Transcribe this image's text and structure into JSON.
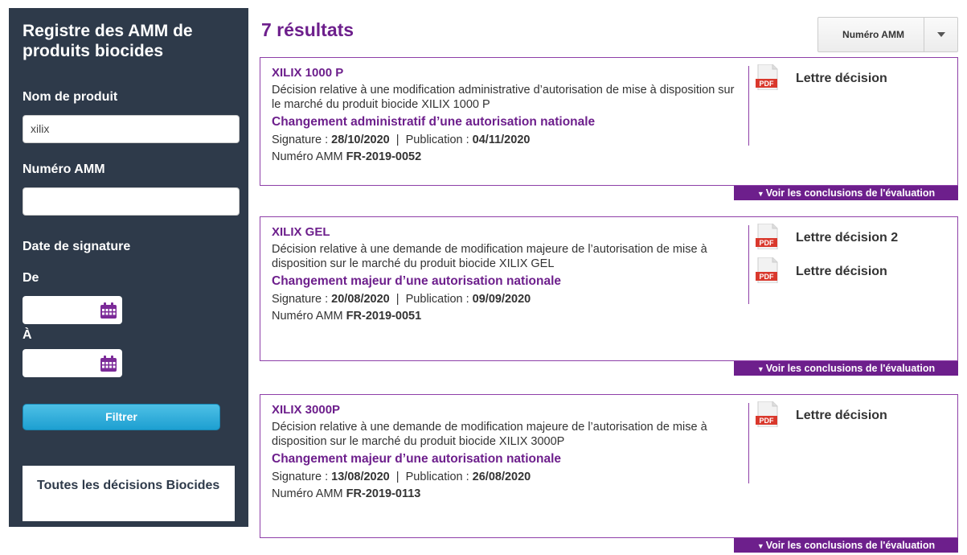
{
  "sidebar": {
    "title": "Registre des AMM de produits biocides",
    "product_name_label": "Nom de produit",
    "product_name_value": "xilix",
    "amm_label": "Numéro AMM",
    "amm_value": "",
    "signature_date_label": "Date de signature",
    "from_label": "De",
    "to_label": "À",
    "filter_button": "Filtrer",
    "all_decisions": "Toutes les décisions Biocides"
  },
  "results": {
    "count_label": "7 résultats",
    "sort_label": "Numéro AMM",
    "eval_link": "Voir les conclusions de l'évaluation",
    "items": [
      {
        "name": "XILIX 1000 P",
        "description": "Décision relative à une modification administrative d’autorisation de mise à disposition sur le marché du produit biocide XILIX 1000 P",
        "type": "Changement administratif d’une autorisation nationale",
        "signature_label": "Signature : ",
        "signature": "28/10/2020",
        "publication_label": "Publication : ",
        "publication": "04/11/2020",
        "amm_label": "Numéro AMM ",
        "amm": "FR-2019-0052",
        "documents": [
          "Lettre décision"
        ]
      },
      {
        "name": "XILIX GEL",
        "description": "Décision relative à une demande de modification majeure de l’autorisation de mise à disposition sur le marché du produit biocide XILIX GEL",
        "type": "Changement majeur d’une autorisation nationale",
        "signature_label": "Signature : ",
        "signature": "20/08/2020",
        "publication_label": "Publication : ",
        "publication": "09/09/2020",
        "amm_label": "Numéro AMM ",
        "amm": "FR-2019-0051",
        "documents": [
          "Lettre décision 2",
          "Lettre décision"
        ]
      },
      {
        "name": "XILIX 3000P",
        "description": "Décision relative à une demande de modification majeure de l’autorisation de mise à disposition sur le marché du produit biocide XILIX 3000P",
        "type": "Changement majeur d’une autorisation nationale",
        "signature_label": "Signature : ",
        "signature": "13/08/2020",
        "publication_label": "Publication : ",
        "publication": "26/08/2020",
        "amm_label": "Numéro AMM ",
        "amm": "FR-2019-0113",
        "documents": [
          "Lettre décision"
        ]
      }
    ]
  },
  "colors": {
    "sidebar_bg": "#2e3a4a",
    "accent_purple": "#6d1f8c",
    "button_blue": "#1d9fd1",
    "pdf_red": "#d9382c"
  },
  "icons": {
    "calendar": "calendar-icon",
    "pdf": "pdf-file-icon",
    "sort_caret": "caret-down-icon",
    "eval_triangle": "triangle-down-icon"
  }
}
